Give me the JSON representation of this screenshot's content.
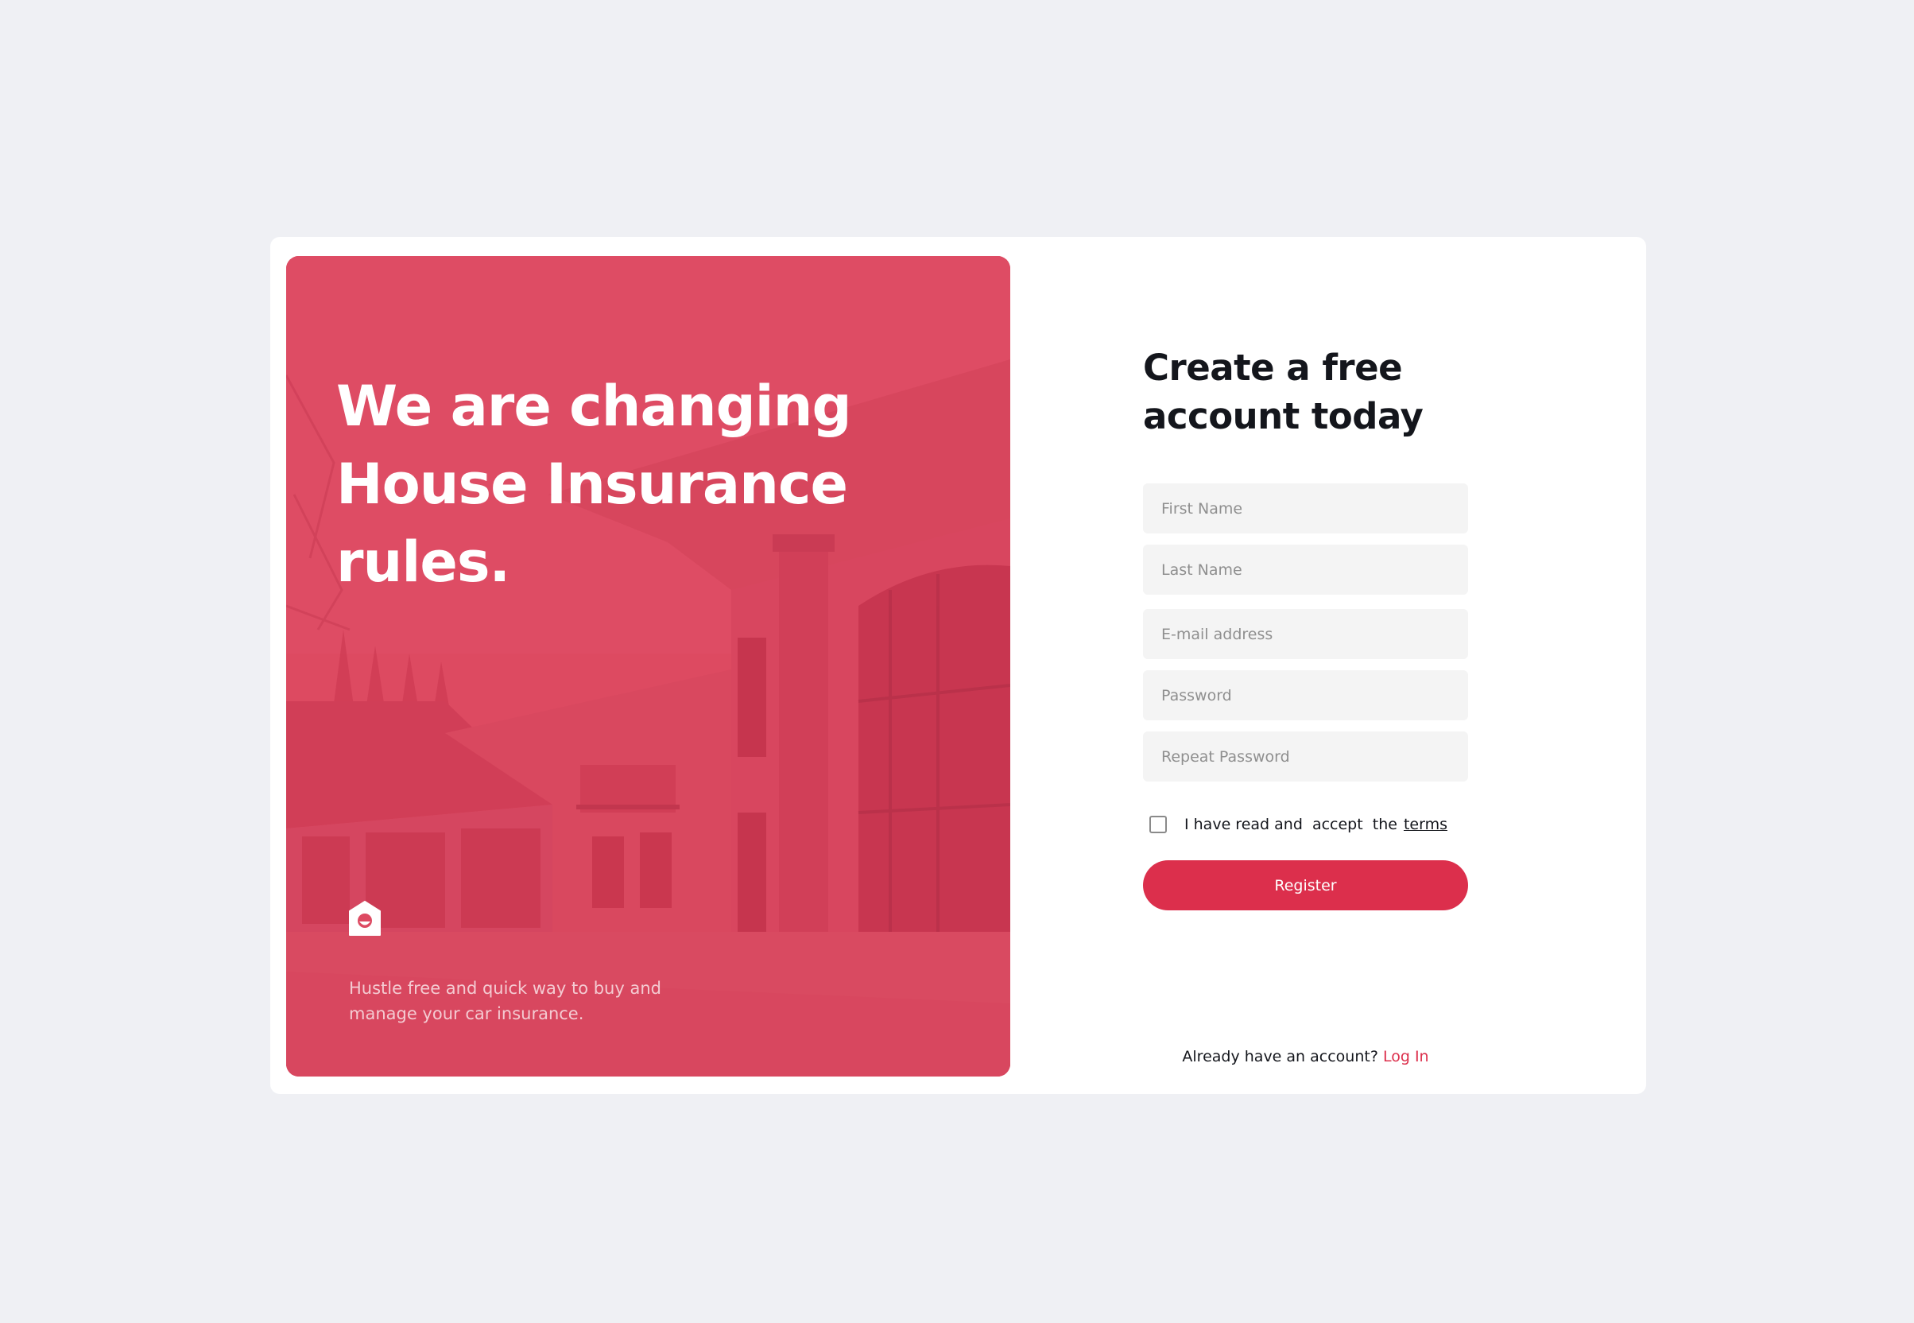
{
  "hero": {
    "title": "We are changing House Insurance rules.",
    "tagline": "Hustle free and quick way to buy and manage your car insurance.",
    "logo_icon": "house-logo-icon",
    "overlay_color": "#dd4a62"
  },
  "form": {
    "title": "Create a free account today",
    "fields": {
      "first_name": {
        "placeholder": "First Name",
        "value": ""
      },
      "last_name": {
        "placeholder": "Last Name",
        "value": ""
      },
      "email": {
        "placeholder": "E-mail address",
        "value": ""
      },
      "password": {
        "placeholder": "Password",
        "value": ""
      },
      "repeat_password": {
        "placeholder": "Repeat Password",
        "value": ""
      }
    },
    "terms": {
      "checked": false,
      "label": "I have read and  accept  the",
      "link": "terms"
    },
    "register_label": "Register",
    "login_prompt": "Already have an account?",
    "login_link": "Log In"
  },
  "colors": {
    "accent": "#dc2f4c",
    "page_background": "#eff0f4",
    "input_background": "#f4f4f4"
  }
}
